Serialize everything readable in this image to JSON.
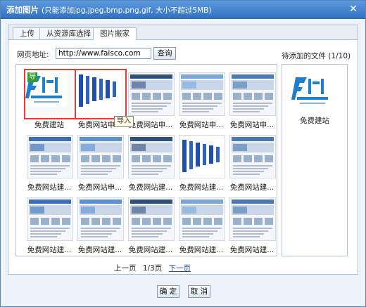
{
  "dialog": {
    "title": "添加图片",
    "hint": "(只能添加jpg,jpeg,bmp,png,gif, 大小不超过5MB)",
    "close_icon": "close-icon"
  },
  "tabs": [
    {
      "label": "上传",
      "active": false
    },
    {
      "label": "从资源库选择",
      "active": false
    },
    {
      "label": "图片搬家",
      "active": true
    }
  ],
  "url_row": {
    "label": "网页地址:",
    "value": "http://www.faisco.com",
    "query_button": "查询"
  },
  "gallery": {
    "items": [
      {
        "caption": "免费建站",
        "selected": true,
        "tag": "导",
        "thumb": "faisco-logo"
      },
      {
        "caption": "免费网站申...",
        "selected": true,
        "thumb": "text-banner"
      },
      {
        "caption": "免费网站申...",
        "selected": false,
        "thumb": "website-screenshot"
      },
      {
        "caption": "免费网站申...",
        "selected": false,
        "thumb": "website-screenshot"
      },
      {
        "caption": "免费网站申...",
        "selected": false,
        "thumb": "website-screenshot"
      },
      {
        "caption": "免费网站建...",
        "selected": false,
        "thumb": "website-screenshot"
      },
      {
        "caption": "免费网站申...",
        "selected": false,
        "thumb": "website-screenshot"
      },
      {
        "caption": "免费网站建...",
        "selected": false,
        "thumb": "website-screenshot"
      },
      {
        "caption": "免费网站建...",
        "selected": false,
        "thumb": "text-banner"
      },
      {
        "caption": "免费网站建...",
        "selected": false,
        "thumb": "website-screenshot"
      },
      {
        "caption": "免费网站建...",
        "selected": false,
        "thumb": "website-screenshot"
      },
      {
        "caption": "免费网站建...",
        "selected": false,
        "thumb": "website-screenshot"
      },
      {
        "caption": "免费网站建...",
        "selected": false,
        "thumb": "website-screenshot"
      },
      {
        "caption": "免费网站建...",
        "selected": false,
        "thumb": "website-screenshot"
      },
      {
        "caption": "免费网站建...",
        "selected": false,
        "thumb": "website-screenshot"
      }
    ],
    "import_tooltip": "导入"
  },
  "pager": {
    "prev": "上一页",
    "page": "1/3页",
    "next": "下一页"
  },
  "pending": {
    "title": "待添加的文件 (1/10)",
    "items": [
      {
        "caption": "免费建站",
        "thumb": "faisco-logo"
      }
    ]
  },
  "footer": {
    "ok": "确 定",
    "cancel": "取 消"
  },
  "colors": {
    "titlebar": "#3a7bd0",
    "selection": "#e03c3c",
    "tag": "#2da12d",
    "logo": "#1f7fcf"
  }
}
